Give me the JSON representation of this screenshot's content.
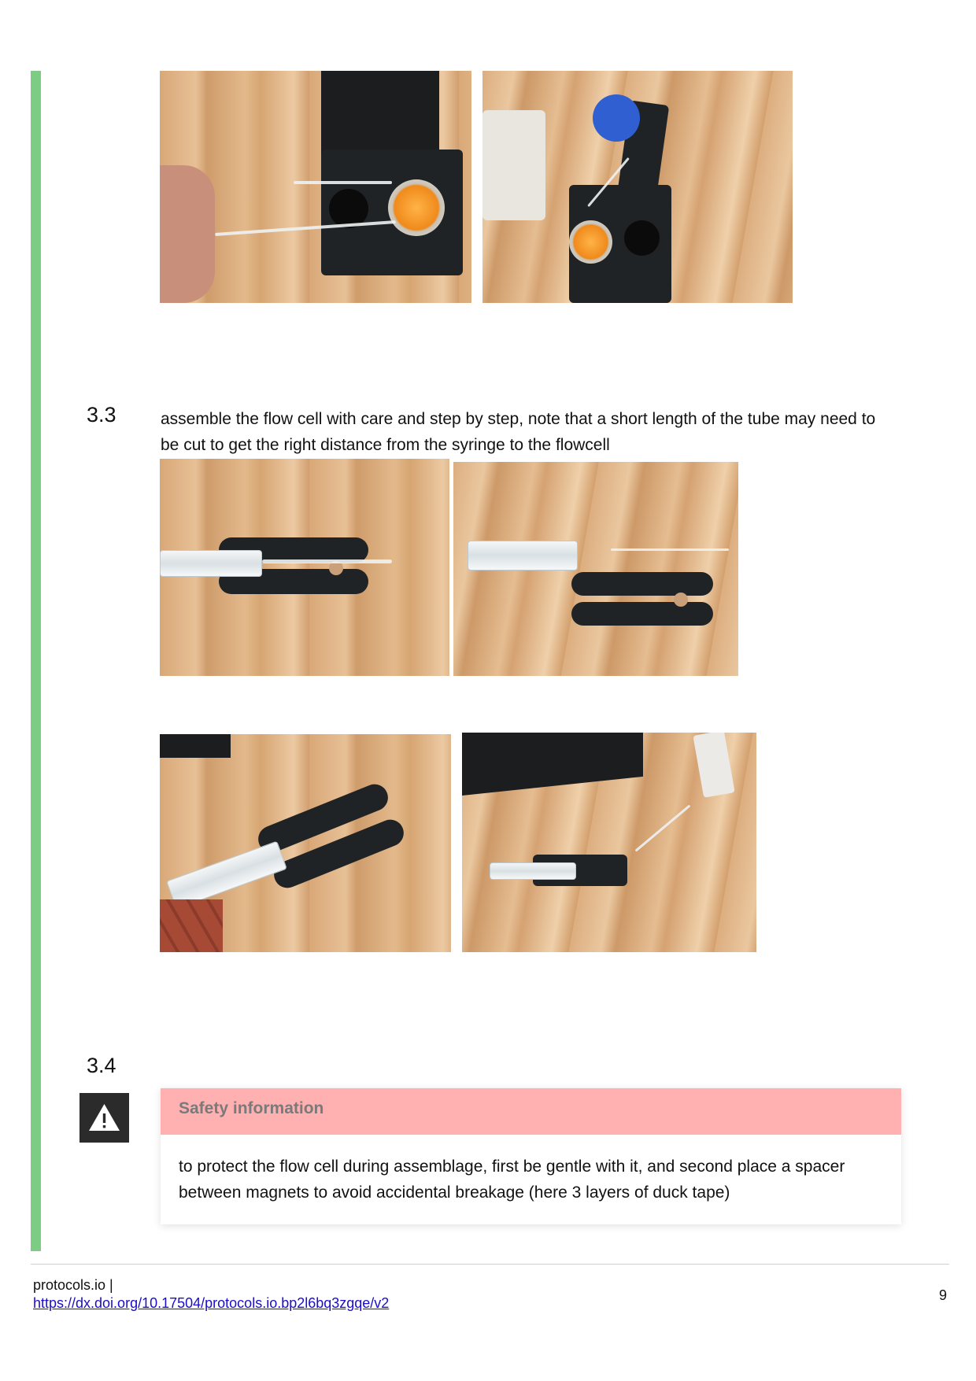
{
  "steps": [
    {
      "number": "3.3",
      "text": "assemble the flow cell with care and step by step, note that a short length of the tube may need to be cut to get the right distance from the syringe to the flowcell"
    },
    {
      "number": "3.4"
    }
  ],
  "safety": {
    "title": "Safety information",
    "body": "to protect the flow cell during assemblage, first be gentle with it, and second place a spacer between magnets to avoid accidental breakage (here 3 layers of duck tape)"
  },
  "footer": {
    "site": "protocols.io |",
    "link": "https://dx.doi.org/10.17504/protocols.io.bp2l6bq3zgqe/v2",
    "page": "9"
  },
  "colors": {
    "step_bar": "#7dcc83",
    "safety_header": "#ffb0b0",
    "link": "#1a0dcc"
  },
  "icons": [
    "warning-icon"
  ]
}
